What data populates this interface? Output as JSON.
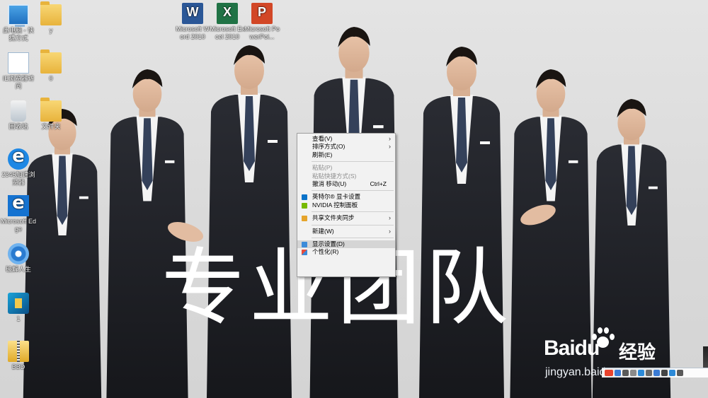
{
  "wallpaper": {
    "slogan": "专业团队"
  },
  "desktop": {
    "icons": [
      {
        "id": "this-pc",
        "label": "此电脑 - 快捷方式",
        "icon": "computer-icon"
      },
      {
        "id": "folder-y",
        "label": "y",
        "icon": "folder-icon"
      },
      {
        "id": "ie-shortcut",
        "label": "IE浏览器访问",
        "icon": "ie-icon"
      },
      {
        "id": "folder-0",
        "label": "0",
        "icon": "folder-icon"
      },
      {
        "id": "recycle-bin",
        "label": "回收站",
        "icon": "recycle-bin-icon"
      },
      {
        "id": "folder-files",
        "label": "文件夹",
        "icon": "folder-icon"
      },
      {
        "id": "ie-2345",
        "label": "2345加速浏览器",
        "icon": "browser-icon"
      },
      {
        "id": "edge",
        "label": "Microsoft Edge",
        "icon": "edge-icon"
      },
      {
        "id": "app-life",
        "label": "破解人生",
        "icon": "gear-icon"
      },
      {
        "id": "game-1",
        "label": "1",
        "icon": "game-icon"
      },
      {
        "id": "archive-bbd",
        "label": "BBD",
        "icon": "archive-icon"
      },
      {
        "id": "word",
        "label": "Microsoft Word 2010",
        "icon": "word-icon"
      },
      {
        "id": "excel",
        "label": "Microsoft Excel 2010",
        "icon": "excel-icon"
      },
      {
        "id": "powerpoint",
        "label": "Microsoft PowerPoi...",
        "icon": "powerpoint-icon"
      }
    ]
  },
  "context_menu": {
    "items": [
      {
        "label": "查看(V)",
        "submenu": true,
        "disabled": false
      },
      {
        "label": "排序方式(O)",
        "submenu": true,
        "disabled": false
      },
      {
        "label": "刷新(E)",
        "submenu": false,
        "disabled": false
      },
      {
        "separator": true
      },
      {
        "label": "粘贴(P)",
        "submenu": false,
        "disabled": true
      },
      {
        "label": "粘贴快捷方式(S)",
        "submenu": false,
        "disabled": true
      },
      {
        "label": "撤消 移动(U)",
        "shortcut": "Ctrl+Z",
        "submenu": false,
        "disabled": false
      },
      {
        "separator": true
      },
      {
        "label": "英特尔® 显卡设置",
        "icon": "intel-graphics-icon",
        "submenu": false,
        "disabled": false
      },
      {
        "label": "NVIDIA 控制面板",
        "icon": "nvidia-icon",
        "submenu": false,
        "disabled": false
      },
      {
        "separator": true
      },
      {
        "label": "共享文件夹同步",
        "icon": "share-sync-icon",
        "submenu": true,
        "disabled": false
      },
      {
        "separator": true
      },
      {
        "label": "新建(W)",
        "submenu": true,
        "disabled": false
      },
      {
        "separator": true
      },
      {
        "label": "显示设置(D)",
        "icon": "display-settings-icon",
        "submenu": false,
        "disabled": false,
        "highlighted": true
      },
      {
        "label": "个性化(R)",
        "icon": "personalize-icon",
        "submenu": false,
        "disabled": false
      }
    ]
  },
  "watermark": {
    "brand_latin": "Baidu",
    "brand_cn": "经验",
    "url": "jingyan.baidu.com"
  }
}
